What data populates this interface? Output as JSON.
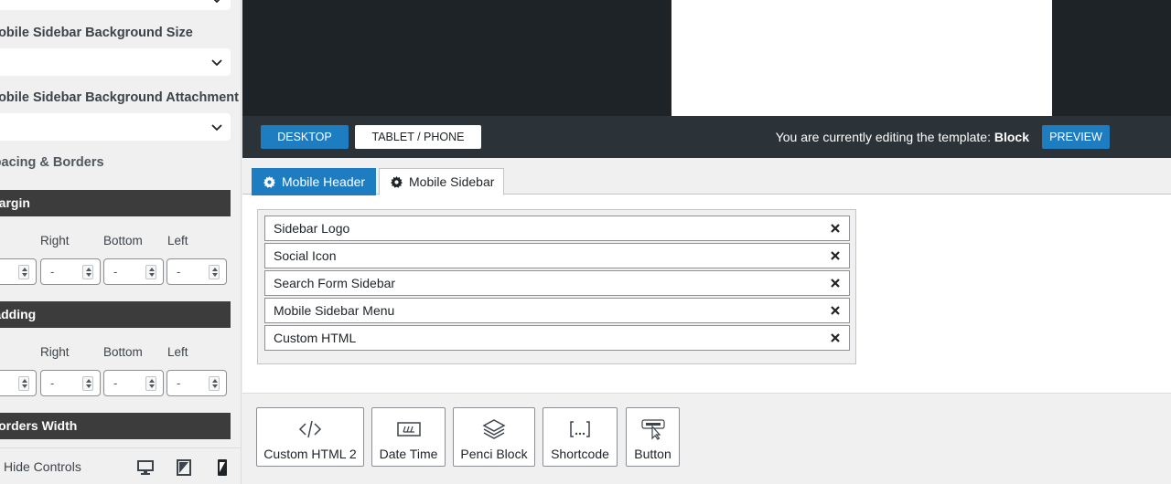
{
  "sidebar": {
    "bg_size_label": "Mobile Sidebar Background Size",
    "bg_attachment_label": "Mobile Sidebar Background Attachment",
    "spacing_title": "Spacing & Borders",
    "margin_title": "Margin",
    "padding_title": "Padding",
    "borders_title": "Borders Width",
    "columns": [
      "Right",
      "Bottom",
      "Left"
    ],
    "empty_value": "-",
    "hide_controls": "Hide Controls"
  },
  "toolbar": {
    "desktop": "DESKTOP",
    "tablet_phone": "TABLET / PHONE",
    "editing_prefix": "You are currently editing the template:",
    "template_name": "Block",
    "preview": "PREVIEW"
  },
  "tabs": [
    {
      "label": "Mobile Header",
      "active": true
    },
    {
      "label": "Mobile Sidebar",
      "active": false
    }
  ],
  "items": [
    "Sidebar Logo",
    "Social Icon",
    "Search Form Sidebar",
    "Mobile Sidebar Menu",
    "Custom HTML"
  ],
  "blocks": [
    {
      "label": "Custom HTML 2",
      "icon": "code-icon"
    },
    {
      "label": "Date Time",
      "icon": "date-time-icon"
    },
    {
      "label": "Penci Block",
      "icon": "layers-icon"
    },
    {
      "label": "Shortcode",
      "icon": "shortcode-icon"
    },
    {
      "label": "Button",
      "icon": "paypal-button-icon"
    }
  ],
  "colors": {
    "accent": "#1e7cc1",
    "dark_bar": "#3c3c3c",
    "toolbar": "#2c3338",
    "preview_dark": "#1e2328"
  }
}
